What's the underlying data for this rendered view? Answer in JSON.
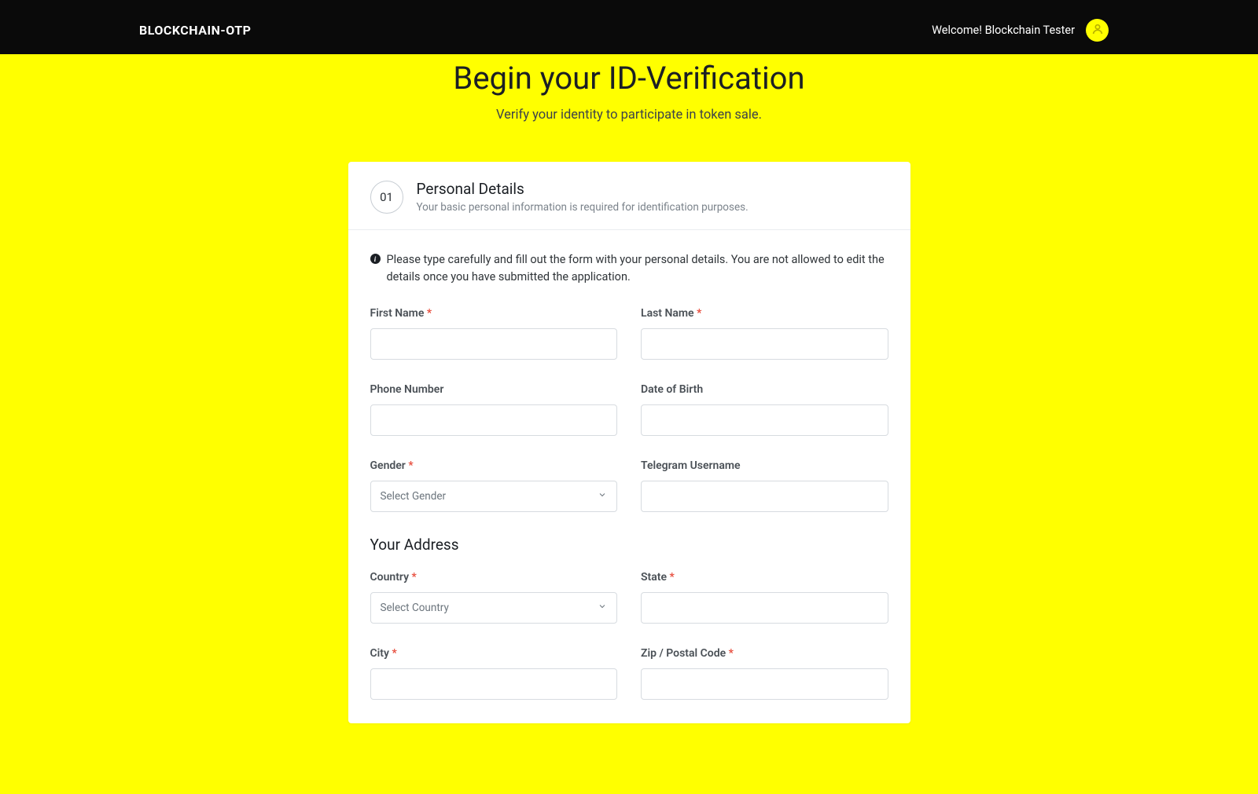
{
  "header": {
    "logo": "BLOCKCHAIN-OTP",
    "welcome": "Welcome! Blockchain Tester"
  },
  "page": {
    "title": "Begin your ID-Verification",
    "subtitle": "Verify your identity to participate in token sale."
  },
  "card": {
    "step": "01",
    "title": "Personal Details",
    "desc": "Your basic personal information is required for identification purposes.",
    "notice": "Please type carefully and fill out the form with your personal details. You are not allowed to edit the details once you have submitted the application."
  },
  "form": {
    "first_name": {
      "label": "First Name ",
      "value": ""
    },
    "last_name": {
      "label": "Last Name ",
      "value": ""
    },
    "phone": {
      "label": "Phone Number",
      "value": ""
    },
    "dob": {
      "label": "Date of Birth",
      "value": ""
    },
    "gender": {
      "label": "Gender ",
      "selected": "Select Gender"
    },
    "telegram": {
      "label": "Telegram Username",
      "value": ""
    },
    "address_title": "Your Address",
    "country": {
      "label": "Country ",
      "selected": "Select Country"
    },
    "state": {
      "label": "State ",
      "value": ""
    },
    "city": {
      "label": "City ",
      "value": ""
    },
    "zip": {
      "label": "Zip / Postal Code ",
      "value": ""
    }
  }
}
